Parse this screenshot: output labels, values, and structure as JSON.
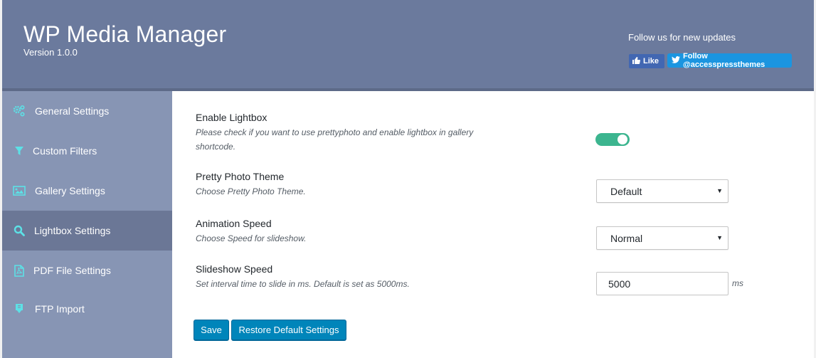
{
  "header": {
    "title": "WP Media Manager",
    "version": "Version 1.0.0",
    "follow_text": "Follow us for new updates",
    "like_label": "Like",
    "twitter_label": "Follow @accesspressthemes"
  },
  "sidebar": {
    "items": [
      {
        "label": "General Settings",
        "icon": "gears-icon",
        "active": false
      },
      {
        "label": "Custom Filters",
        "icon": "filter-icon",
        "active": false
      },
      {
        "label": "Gallery Settings",
        "icon": "image-icon",
        "active": false
      },
      {
        "label": "Lightbox Settings",
        "icon": "search-icon",
        "active": true
      },
      {
        "label": "PDF File Settings",
        "icon": "pdf-file-icon",
        "active": false
      },
      {
        "label": "FTP Import",
        "icon": "import-icon",
        "active": false
      }
    ]
  },
  "settings": {
    "lightbox": {
      "title": "Enable Lightbox",
      "desc": "Please check if you want to use prettyphoto and enable lightbox in gallery shortcode.",
      "enabled": true
    },
    "theme": {
      "title": "Pretty Photo Theme",
      "desc": "Choose Pretty Photo Theme.",
      "value": "Default"
    },
    "animation": {
      "title": "Animation Speed",
      "desc": "Choose Speed for slideshow.",
      "value": "Normal"
    },
    "slideshow": {
      "title": "Slideshow Speed",
      "desc": "Set interval time to slide in ms. Default is set as 5000ms.",
      "value": "5000",
      "unit": "ms"
    }
  },
  "buttons": {
    "save": "Save",
    "restore": "Restore Default Settings"
  },
  "colors": {
    "header_bg": "#6b7a9d",
    "sidebar_bg": "#8795b4",
    "sidebar_active": "#6b7796",
    "icon_accent": "#5ce1e6",
    "toggle_on": "#3cb58f",
    "button_primary": "#0085ba"
  }
}
